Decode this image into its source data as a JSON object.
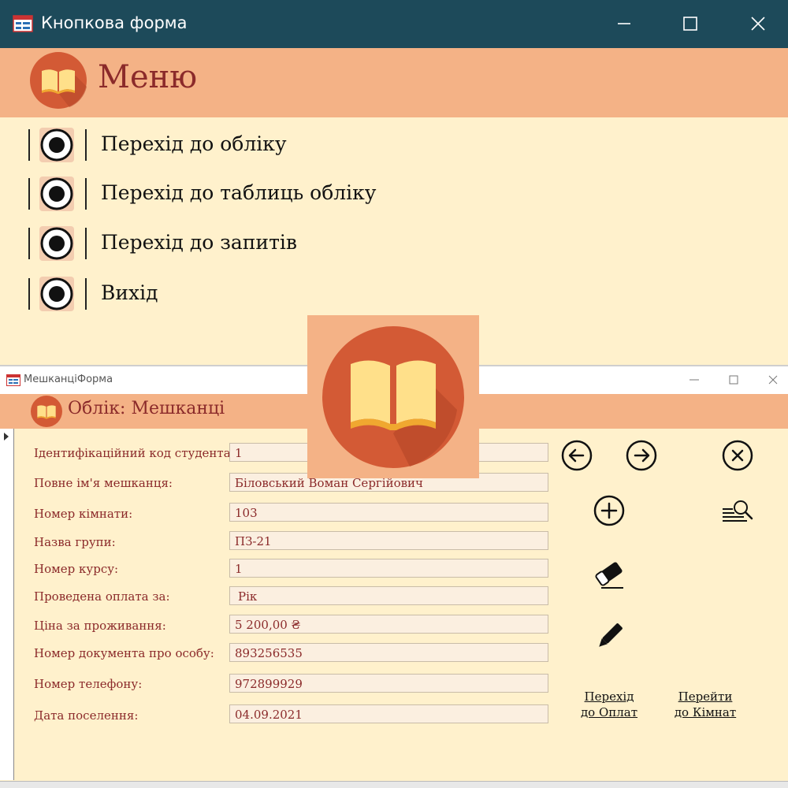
{
  "window": {
    "title": "Кнопкова форма"
  },
  "menu": {
    "title": "Меню",
    "items": [
      {
        "label": "Перехід до обліку"
      },
      {
        "label": "Перехід до таблиць обліку"
      },
      {
        "label": "Перехід до запитів"
      },
      {
        "label": "Вихід"
      }
    ]
  },
  "subform": {
    "window_title": "МешканціФорма",
    "heading": "Облік: Мешканці",
    "fields": [
      {
        "label": "Ідентифікаційний код студента:",
        "value": "1"
      },
      {
        "label": "Повне ім'я мешканця:",
        "value": "Біловський Воман Сергійович"
      },
      {
        "label": "Номер кімнати:",
        "value": "103"
      },
      {
        "label": "Назва групи:",
        "value": "ПЗ-21"
      },
      {
        "label": "Номер курсу:",
        "value": "1"
      },
      {
        "label": "Проведена оплата за:",
        "value": "Рік"
      },
      {
        "label": "Ціна за проживання:",
        "value": "5 200,00 ₴"
      },
      {
        "label": "Номер документа про особу:",
        "value": "893256535"
      },
      {
        "label": "Номер телефону:",
        "value": "972899929"
      },
      {
        "label": "Дата поселення:",
        "value": "04.09.2021"
      }
    ],
    "buttons": {
      "prev_icon": "arrow-left-circle-icon",
      "next_icon": "arrow-right-circle-icon",
      "close_icon": "close-circle-icon",
      "add_icon": "plus-circle-icon",
      "search_icon": "search-list-icon",
      "erase_icon": "eraser-icon",
      "edit_icon": "pen-icon",
      "payments_link": [
        "Перехід",
        "до Оплат"
      ],
      "rooms_link": [
        "Перейти",
        "до Кімнат"
      ]
    }
  },
  "colors": {
    "titlebar": "#1d4a5a",
    "header": "#f4b286",
    "body": "#fff1cc",
    "label": "#8b2a2a",
    "logo_circle": "#d35a35",
    "logo_book": "#ffe08a"
  }
}
